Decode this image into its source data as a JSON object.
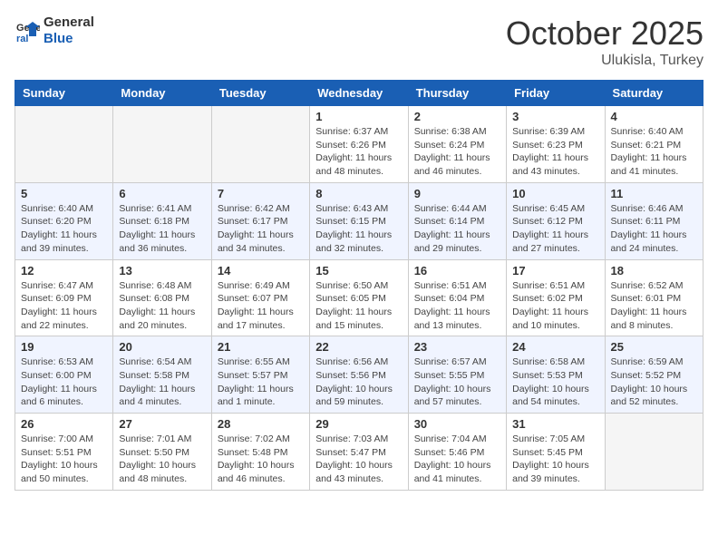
{
  "logo": {
    "name1": "General",
    "name2": "Blue"
  },
  "title": "October 2025",
  "location": "Ulukisla, Turkey",
  "weekdays": [
    "Sunday",
    "Monday",
    "Tuesday",
    "Wednesday",
    "Thursday",
    "Friday",
    "Saturday"
  ],
  "weeks": [
    [
      {
        "day": "",
        "info": ""
      },
      {
        "day": "",
        "info": ""
      },
      {
        "day": "",
        "info": ""
      },
      {
        "day": "1",
        "info": "Sunrise: 6:37 AM\nSunset: 6:26 PM\nDaylight: 11 hours\nand 48 minutes."
      },
      {
        "day": "2",
        "info": "Sunrise: 6:38 AM\nSunset: 6:24 PM\nDaylight: 11 hours\nand 46 minutes."
      },
      {
        "day": "3",
        "info": "Sunrise: 6:39 AM\nSunset: 6:23 PM\nDaylight: 11 hours\nand 43 minutes."
      },
      {
        "day": "4",
        "info": "Sunrise: 6:40 AM\nSunset: 6:21 PM\nDaylight: 11 hours\nand 41 minutes."
      }
    ],
    [
      {
        "day": "5",
        "info": "Sunrise: 6:40 AM\nSunset: 6:20 PM\nDaylight: 11 hours\nand 39 minutes."
      },
      {
        "day": "6",
        "info": "Sunrise: 6:41 AM\nSunset: 6:18 PM\nDaylight: 11 hours\nand 36 minutes."
      },
      {
        "day": "7",
        "info": "Sunrise: 6:42 AM\nSunset: 6:17 PM\nDaylight: 11 hours\nand 34 minutes."
      },
      {
        "day": "8",
        "info": "Sunrise: 6:43 AM\nSunset: 6:15 PM\nDaylight: 11 hours\nand 32 minutes."
      },
      {
        "day": "9",
        "info": "Sunrise: 6:44 AM\nSunset: 6:14 PM\nDaylight: 11 hours\nand 29 minutes."
      },
      {
        "day": "10",
        "info": "Sunrise: 6:45 AM\nSunset: 6:12 PM\nDaylight: 11 hours\nand 27 minutes."
      },
      {
        "day": "11",
        "info": "Sunrise: 6:46 AM\nSunset: 6:11 PM\nDaylight: 11 hours\nand 24 minutes."
      }
    ],
    [
      {
        "day": "12",
        "info": "Sunrise: 6:47 AM\nSunset: 6:09 PM\nDaylight: 11 hours\nand 22 minutes."
      },
      {
        "day": "13",
        "info": "Sunrise: 6:48 AM\nSunset: 6:08 PM\nDaylight: 11 hours\nand 20 minutes."
      },
      {
        "day": "14",
        "info": "Sunrise: 6:49 AM\nSunset: 6:07 PM\nDaylight: 11 hours\nand 17 minutes."
      },
      {
        "day": "15",
        "info": "Sunrise: 6:50 AM\nSunset: 6:05 PM\nDaylight: 11 hours\nand 15 minutes."
      },
      {
        "day": "16",
        "info": "Sunrise: 6:51 AM\nSunset: 6:04 PM\nDaylight: 11 hours\nand 13 minutes."
      },
      {
        "day": "17",
        "info": "Sunrise: 6:51 AM\nSunset: 6:02 PM\nDaylight: 11 hours\nand 10 minutes."
      },
      {
        "day": "18",
        "info": "Sunrise: 6:52 AM\nSunset: 6:01 PM\nDaylight: 11 hours\nand 8 minutes."
      }
    ],
    [
      {
        "day": "19",
        "info": "Sunrise: 6:53 AM\nSunset: 6:00 PM\nDaylight: 11 hours\nand 6 minutes."
      },
      {
        "day": "20",
        "info": "Sunrise: 6:54 AM\nSunset: 5:58 PM\nDaylight: 11 hours\nand 4 minutes."
      },
      {
        "day": "21",
        "info": "Sunrise: 6:55 AM\nSunset: 5:57 PM\nDaylight: 11 hours\nand 1 minute."
      },
      {
        "day": "22",
        "info": "Sunrise: 6:56 AM\nSunset: 5:56 PM\nDaylight: 10 hours\nand 59 minutes."
      },
      {
        "day": "23",
        "info": "Sunrise: 6:57 AM\nSunset: 5:55 PM\nDaylight: 10 hours\nand 57 minutes."
      },
      {
        "day": "24",
        "info": "Sunrise: 6:58 AM\nSunset: 5:53 PM\nDaylight: 10 hours\nand 54 minutes."
      },
      {
        "day": "25",
        "info": "Sunrise: 6:59 AM\nSunset: 5:52 PM\nDaylight: 10 hours\nand 52 minutes."
      }
    ],
    [
      {
        "day": "26",
        "info": "Sunrise: 7:00 AM\nSunset: 5:51 PM\nDaylight: 10 hours\nand 50 minutes."
      },
      {
        "day": "27",
        "info": "Sunrise: 7:01 AM\nSunset: 5:50 PM\nDaylight: 10 hours\nand 48 minutes."
      },
      {
        "day": "28",
        "info": "Sunrise: 7:02 AM\nSunset: 5:48 PM\nDaylight: 10 hours\nand 46 minutes."
      },
      {
        "day": "29",
        "info": "Sunrise: 7:03 AM\nSunset: 5:47 PM\nDaylight: 10 hours\nand 43 minutes."
      },
      {
        "day": "30",
        "info": "Sunrise: 7:04 AM\nSunset: 5:46 PM\nDaylight: 10 hours\nand 41 minutes."
      },
      {
        "day": "31",
        "info": "Sunrise: 7:05 AM\nSunset: 5:45 PM\nDaylight: 10 hours\nand 39 minutes."
      },
      {
        "day": "",
        "info": ""
      }
    ]
  ]
}
